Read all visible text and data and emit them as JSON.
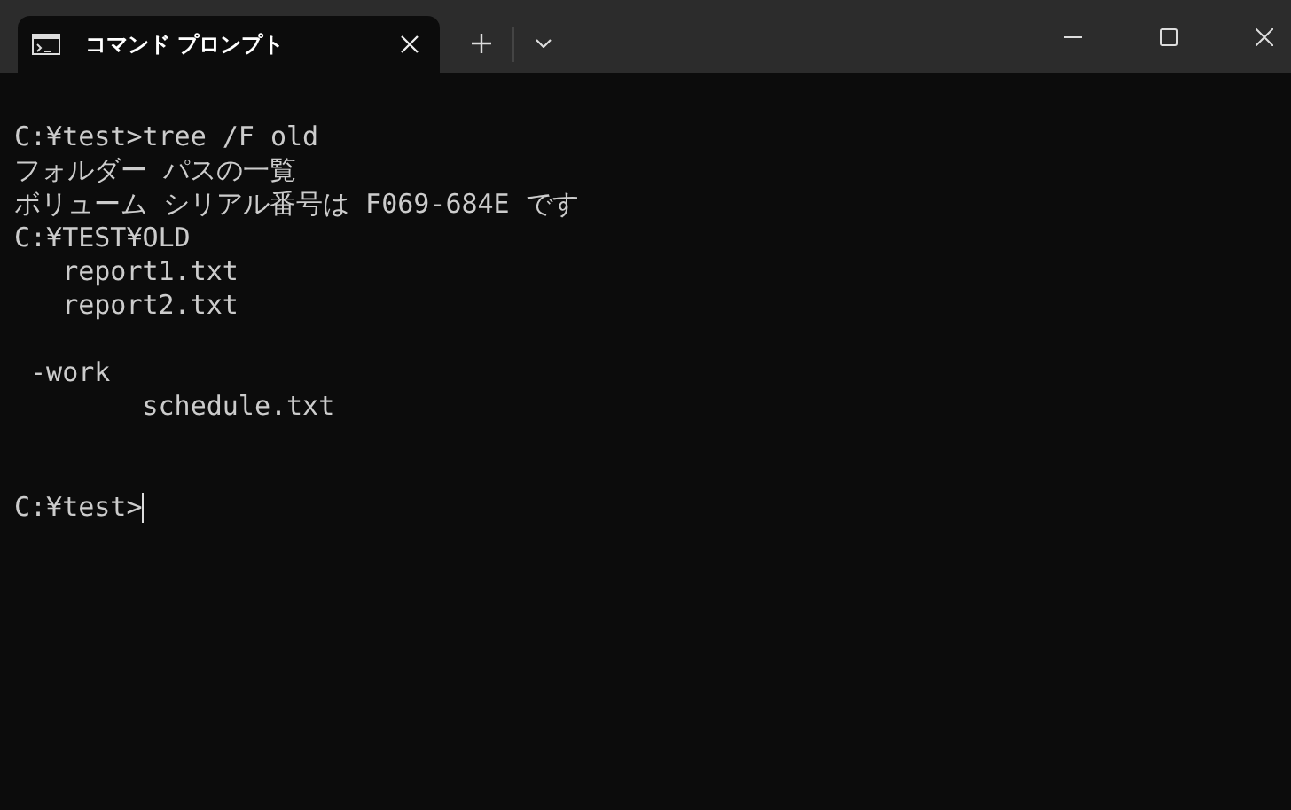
{
  "tab": {
    "title": "コマンド プロンプト",
    "selected": true
  },
  "console": {
    "lines": [
      {
        "kind": "text",
        "text": "C:¥test>tree /F old"
      },
      {
        "kind": "text",
        "text": "フォルダー パスの一覧"
      },
      {
        "kind": "text",
        "text": "ボリューム シリアル番号は F069-684E です"
      },
      {
        "kind": "text",
        "text": "C:¥TEST¥OLD"
      },
      {
        "kind": "text",
        "text": "   report1.txt"
      },
      {
        "kind": "text",
        "text": "   report2.txt"
      },
      {
        "kind": "blank"
      },
      {
        "kind": "text",
        "text": " -work"
      },
      {
        "kind": "text",
        "text": "        schedule.txt"
      },
      {
        "kind": "blank"
      },
      {
        "kind": "blank"
      },
      {
        "kind": "prompt",
        "text": "C:¥test>"
      }
    ]
  }
}
